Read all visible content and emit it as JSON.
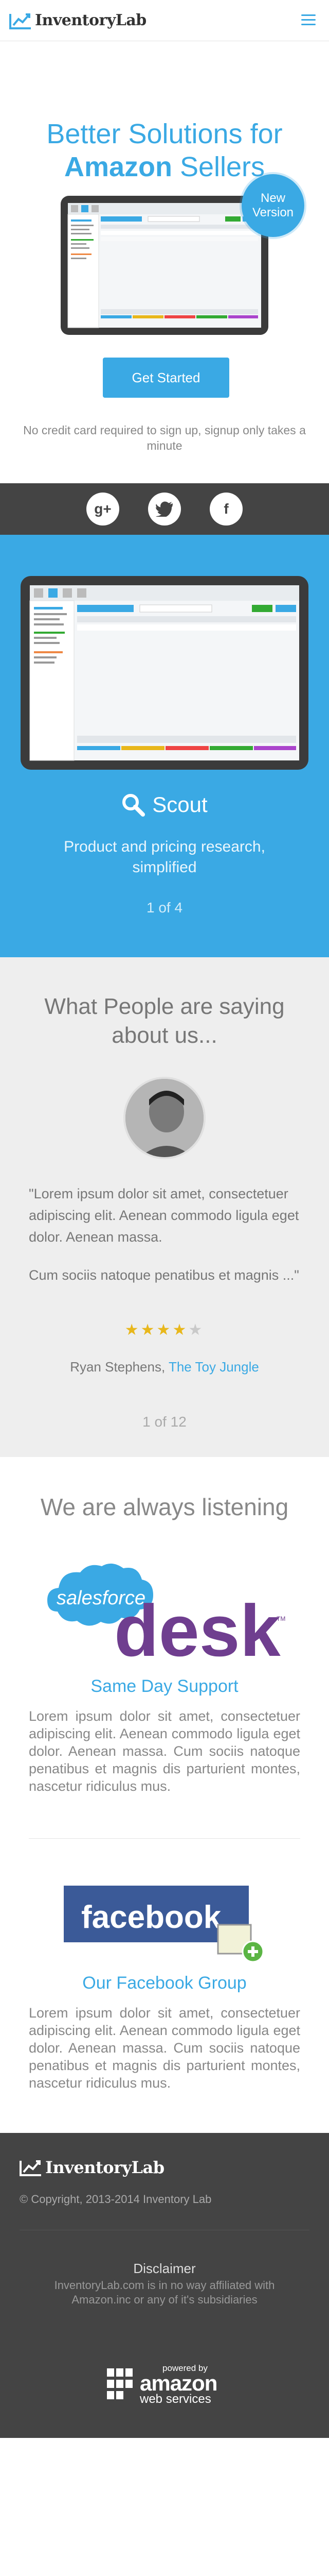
{
  "header": {
    "brand": "InventoryLab",
    "menu_icon": "hamburger-icon",
    "accent": "#3aa9e4"
  },
  "hero": {
    "title_line1": "Better Solutions for",
    "title_bold": "Amazon",
    "title_rest": " Sellers",
    "badge_line1": "New",
    "badge_line2": "Version",
    "cta_label": "Get Started",
    "note": "No credit card required to sign up, signup only takes a minute"
  },
  "social": {
    "items": [
      {
        "name": "google-plus-icon",
        "glyph": "g+"
      },
      {
        "name": "twitter-icon",
        "glyph": "🐦"
      },
      {
        "name": "facebook-icon",
        "glyph": "f"
      }
    ]
  },
  "feature": {
    "title": "Scout",
    "icon": "search-icon",
    "description": "Product and pricing research, simplified",
    "counter": "1 of 4"
  },
  "testimonials": {
    "heading": "What People are saying about us...",
    "quote_p1": "\"Lorem ipsum dolor sit amet, consectetuer adipiscing elit. Aenean commodo ligula eget dolor. Aenean massa.",
    "quote_p2": "Cum sociis natoque penatibus et magnis ...\"",
    "rating": 4,
    "rating_max": 5,
    "author_name": "Ryan Stephens, ",
    "author_company": "The Toy Jungle",
    "counter": "1 of 12"
  },
  "listening": {
    "heading": "We are always listening",
    "desk_logo_small": "salesforce",
    "desk_logo_big": "desk",
    "desk_tm": "TM",
    "support_title": "Same Day Support",
    "support_text": "Lorem ipsum dolor sit amet, consectetuer adipiscing elit. Aenean commodo ligula eget dolor. Aenean massa. Cum sociis natoque penatibus et magnis dis parturient montes, nascetur ridiculus mus.",
    "fb_logo": "facebook",
    "group_title": "Our Facebook Group",
    "group_text": "Lorem ipsum dolor sit amet, consectetuer adipiscing elit. Aenean commodo ligula eget dolor. Aenean massa. Cum sociis natoque penatibus et magnis dis parturient montes, nascetur ridiculus mus."
  },
  "footer": {
    "brand": "InventoryLab",
    "copyright": "© Copyright, 2013-2014 Inventory Lab",
    "disclaimer_title": "Disclaimer",
    "disclaimer_text": "InventoryLab.com is in no way affiliated with Amazon.inc or any of it's subsidiaries",
    "aws_powered": "powered by",
    "aws_amazon": "amazon",
    "aws_ws": "web services"
  }
}
